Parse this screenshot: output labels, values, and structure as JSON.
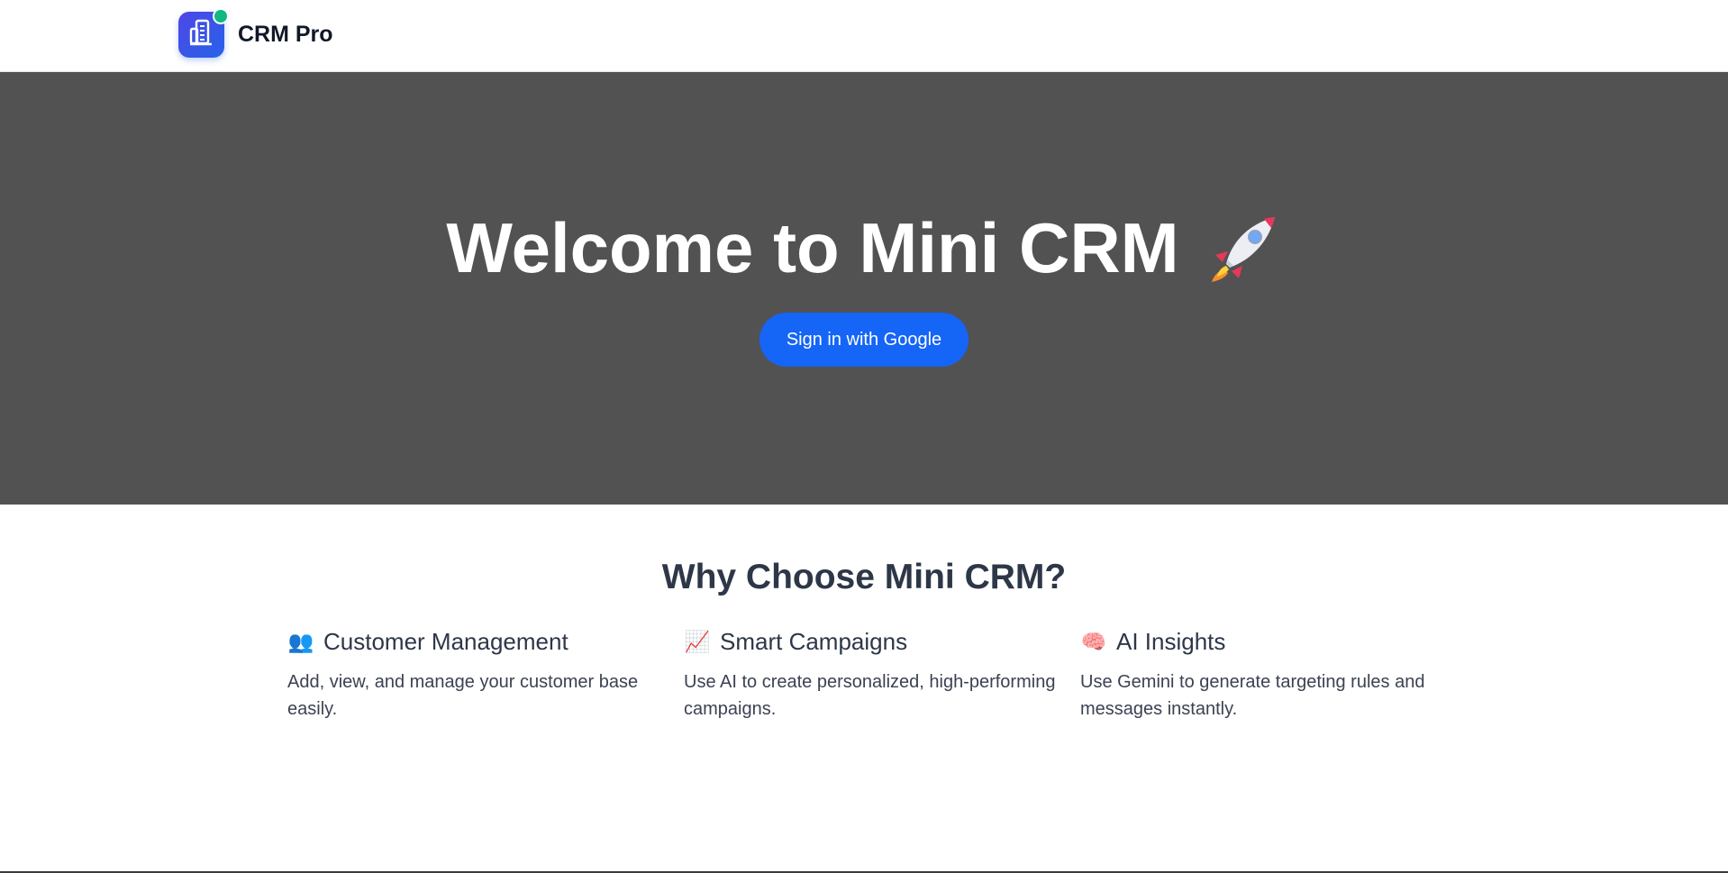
{
  "navbar": {
    "brand_name": "CRM Pro",
    "logo_icon": "building-icon",
    "status_color": "#10b981"
  },
  "hero": {
    "title": "Welcome to Mini CRM",
    "title_emoji": "rocket-icon",
    "signin_label": "Sign in with Google",
    "button_color": "#1565f6",
    "background": "#525252"
  },
  "features": {
    "heading": "Why Choose Mini CRM?",
    "items": [
      {
        "icon": "👥",
        "icon_name": "people-icon",
        "title": "Customer Management",
        "description": "Add, view, and manage your customer base easily."
      },
      {
        "icon": "📈",
        "icon_name": "chart-up-icon",
        "title": "Smart Campaigns",
        "description": "Use AI to create personalized, high-performing campaigns."
      },
      {
        "icon": "🧠",
        "icon_name": "brain-icon",
        "title": "AI Insights",
        "description": "Use Gemini to generate targeting rules and messages instantly."
      }
    ]
  }
}
